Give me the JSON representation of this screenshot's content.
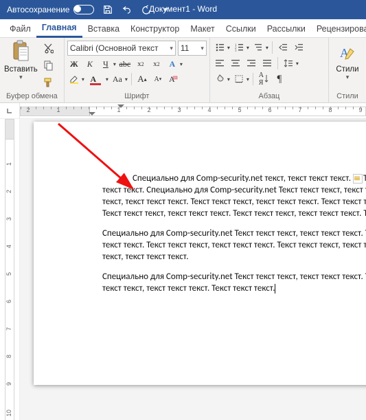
{
  "titlebar": {
    "autosave_label": "Автосохранение",
    "doc_title": "Документ1 - Word"
  },
  "tabs": {
    "file": "Файл",
    "home": "Главная",
    "insert": "Вставка",
    "design": "Конструктор",
    "layout": "Макет",
    "references": "Ссылки",
    "mailings": "Рассылки",
    "review": "Рецензирова"
  },
  "ribbon": {
    "clipboard": {
      "paste": "Вставить",
      "group_title": "Буфер обмена"
    },
    "font": {
      "font_name": "Calibri (Основной текст",
      "font_size": "11",
      "group_title": "Шрифт"
    },
    "paragraph": {
      "group_title": "Абзац"
    },
    "styles": {
      "button_label": "Стили",
      "group_title": "Стили"
    }
  },
  "document": {
    "paragraphs": [
      "Специально для Comp-security.net текст, текст текст текст. Текст текст текст, текст текст текст. Текст текст текст, текст текст текст. Специально для Comp-security.net Текст текст текст, текст текст текст. Текст текст текст, текст текст текст. Текст текст текст, текст текст текст. Текст текст текст, текст текст текст. Текст текст текст, текст текст текст. Текст текст текст, текст текст текст. Текст текст текст, текст текст текст. Текст текст текст, текст текст текст. Текст текст текст",
      "Специально для Comp-security.net Текст текст текст, текст текст текст. Текст текст текст, текст текст текст. Текст текст текст, текст текст текст. Текст текст текст, текст текст текст. Текст текст текст, текст текст текст. Текст текст текст, текст текст текст. Текст текст текст, текст текст текст.",
      "Специально для Comp-security.net Текст текст текст, текст текст текст. Текст текст текст, текст текст текст. Текст текст текст, текст текст текст, текст текст текст. Текст текст текст."
    ]
  },
  "ruler": {
    "hnums": [
      "2",
      "1",
      "1",
      "2",
      "3",
      "4",
      "5",
      "6",
      "7",
      "8"
    ]
  }
}
